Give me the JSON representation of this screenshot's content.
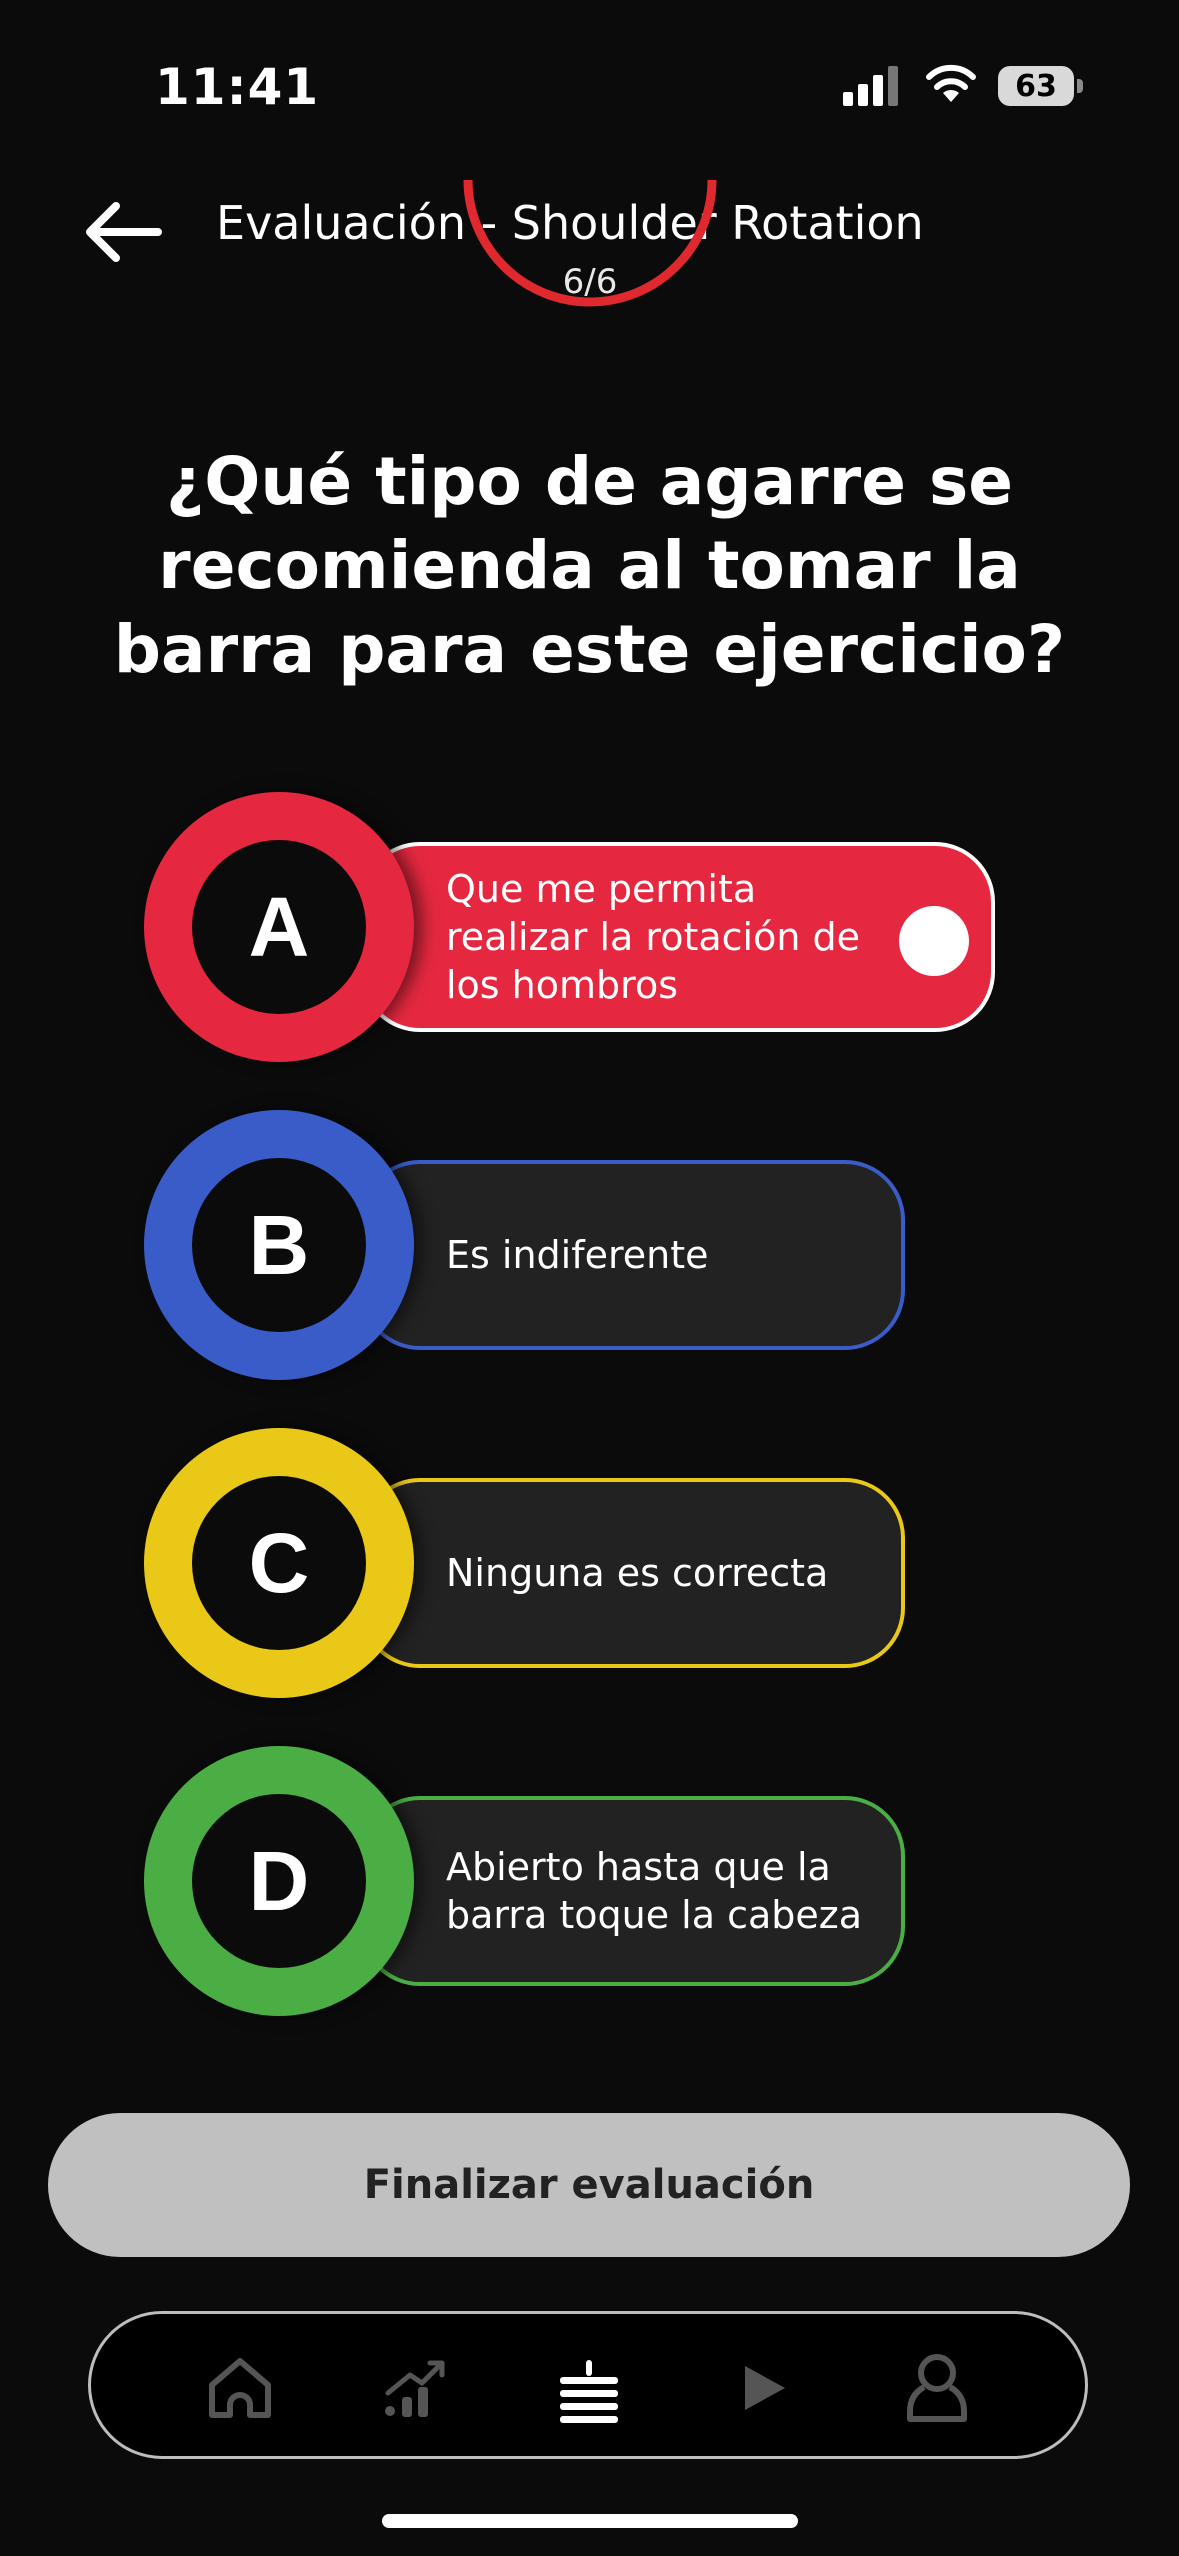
{
  "status": {
    "time": "11:41",
    "battery": "63"
  },
  "header": {
    "title": "Evaluación - Shoulder Rotation"
  },
  "progress": {
    "label": "6/6"
  },
  "question": {
    "text": "¿Qué tipo de agarre se recomienda al tomar la barra para este ejercicio?"
  },
  "options": [
    {
      "letter": "A",
      "text": "Que me permita realizar la rotación de los hombros",
      "color": "#e5283f",
      "selected": true
    },
    {
      "letter": "B",
      "text": "Es indiferente",
      "color": "#3a5cc9",
      "selected": false
    },
    {
      "letter": "C",
      "text": "Ninguna es correcta",
      "color": "#e9c818",
      "selected": false
    },
    {
      "letter": "D",
      "text": "Abierto hasta que la barra toque la cabeza",
      "color": "#4aae44",
      "selected": false
    }
  ],
  "footer": {
    "finish_label": "Finalizar evaluación"
  },
  "tabbar": {
    "items": [
      "home-icon",
      "stats-icon",
      "list-icon",
      "play-icon",
      "profile-icon"
    ],
    "active": "list-icon"
  }
}
